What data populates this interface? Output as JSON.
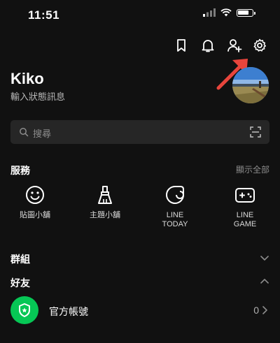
{
  "status_bar": {
    "time": "11:51"
  },
  "header_icons": [
    "bookmark-icon",
    "bell-icon",
    "add-friend-icon",
    "gear-icon"
  ],
  "profile": {
    "name": "Kiko",
    "status_message": "輸入狀態訊息"
  },
  "search": {
    "placeholder": "搜尋"
  },
  "services": {
    "title": "服務",
    "show_all": "顯示全部",
    "items": [
      {
        "label": "貼圖小舖",
        "icon": "smiley-icon"
      },
      {
        "label": "主題小舖",
        "icon": "brush-icon"
      },
      {
        "label": "LINE\nTODAY",
        "icon": "line-today-icon"
      },
      {
        "label": "LINE\nGAME",
        "icon": "gamepad-icon"
      }
    ]
  },
  "groups": {
    "title": "群組"
  },
  "friends": {
    "title": "好友"
  },
  "official_account": {
    "label": "官方帳號",
    "count": "0"
  },
  "colors": {
    "background": "#111111",
    "accent_green": "#06c755",
    "arrow_red": "#e8453c"
  }
}
